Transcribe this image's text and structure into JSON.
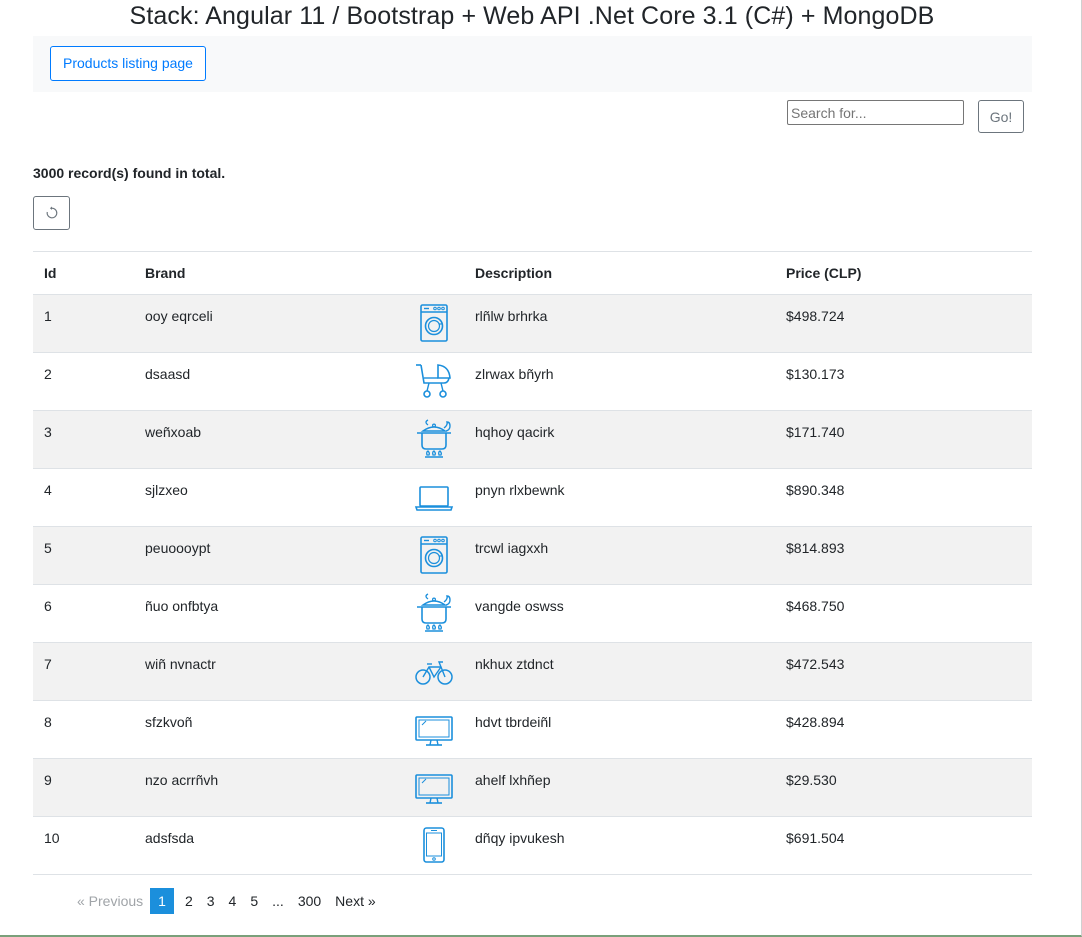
{
  "page": {
    "title": "Stack: Angular 11 / Bootstrap + Web API .Net Core 3.1 (C#) + MongoDB"
  },
  "navbar": {
    "products_button": "Products listing page"
  },
  "search": {
    "placeholder": "Search for...",
    "value": "",
    "go_label": "Go!"
  },
  "summary": {
    "records_text": "3000 record(s) found in total."
  },
  "refresh": {
    "icon": "refresh-icon"
  },
  "table": {
    "headers": {
      "id": "Id",
      "brand": "Brand",
      "image": "",
      "description": "Description",
      "price": "Price (CLP)"
    },
    "rows": [
      {
        "id": "1",
        "brand": "ooy eqrceli",
        "icon": "washing-machine-icon",
        "description": "rlñlw brhrka",
        "price": "$498.724"
      },
      {
        "id": "2",
        "brand": "dsaasd",
        "icon": "baby-stroller-icon",
        "description": "zlrwax bñyrh",
        "price": "$130.173"
      },
      {
        "id": "3",
        "brand": "weñxoab",
        "icon": "cooking-pot-icon",
        "description": "hqhoy qacirk",
        "price": "$171.740"
      },
      {
        "id": "4",
        "brand": "sjlzxeo",
        "icon": "laptop-icon",
        "description": "pnyn rlxbewnk",
        "price": "$890.348"
      },
      {
        "id": "5",
        "brand": "peuoooypt",
        "icon": "washing-machine-icon",
        "description": "trcwl iagxxh",
        "price": "$814.893"
      },
      {
        "id": "6",
        "brand": "ñuo onfbtya",
        "icon": "cooking-pot-icon",
        "description": "vangde oswss",
        "price": "$468.750"
      },
      {
        "id": "7",
        "brand": "wiñ nvnactr",
        "icon": "bicycle-icon",
        "description": "nkhux ztdnct",
        "price": "$472.543"
      },
      {
        "id": "8",
        "brand": "sfzkvoñ",
        "icon": "monitor-icon",
        "description": "hdvt tbrdeiñl",
        "price": "$428.894"
      },
      {
        "id": "9",
        "brand": "nzo acrrñvh",
        "icon": "monitor-icon",
        "description": "ahelf lxhñep",
        "price": "$29.530"
      },
      {
        "id": "10",
        "brand": "adsfsda",
        "icon": "smartphone-icon",
        "description": "dñqy ipvukesh",
        "price": "$691.504"
      }
    ]
  },
  "pagination": {
    "previous": "«  Previous",
    "pages": [
      "1",
      "2",
      "3",
      "4",
      "5",
      "...",
      "300"
    ],
    "active_page": "1",
    "next": "Next  »"
  },
  "colors": {
    "primary": "#007bff",
    "icon_blue": "#1b8fdc",
    "stripe": "#f2f2f2"
  }
}
